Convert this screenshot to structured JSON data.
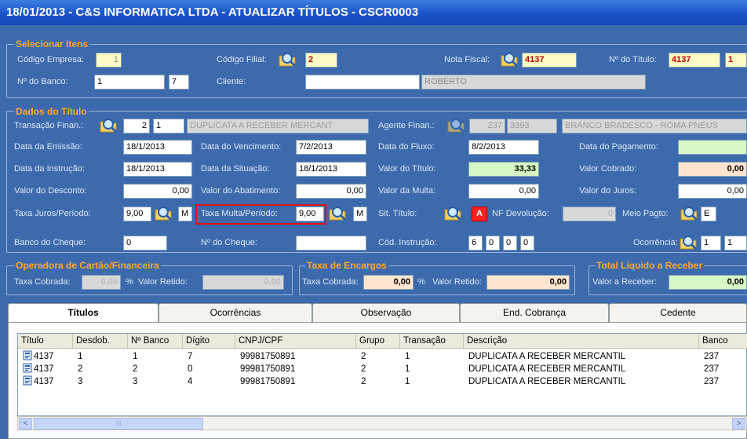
{
  "window": {
    "title": "18/01/2013  -  C&S INFORMATICA LTDA  -  ATUALIZAR TÍTULOS  -  CSCR0003"
  },
  "selecionar": {
    "section_title": "Selecionar Itens",
    "codigo_empresa_label": "Código Empresa:",
    "codigo_empresa": "1",
    "codigo_filial_label": "Código Filial:",
    "codigo_filial": "2",
    "nota_fiscal_label": "Nota Fiscal:",
    "nota_fiscal": "4137",
    "numero_titulo_label": "Nº do Título:",
    "numero_titulo": "4137",
    "numero_titulo_seq": "1",
    "banco_label": "Nº do Banco:",
    "banco": "1",
    "banco_digito": "7",
    "cliente_label": "Cliente:",
    "cliente_codigo": "",
    "cliente_nome": "ROBERTO"
  },
  "dados": {
    "section_title": "Dados do Título",
    "transacao_label": "Transação Finan.:",
    "transacao_1": "2",
    "transacao_2": "1",
    "transacao_desc": "DUPLICATA  A RECEBER MERCANT",
    "agente_label": "Agente Finan.:",
    "agente_1": "237",
    "agente_2": "3393",
    "agente_desc": "BRANCO BRADESCO - ROMA PNEUS",
    "emissao_label": "Data  da Emissão:",
    "emissao": "18/1/2013",
    "vencimento_label": "Data do Vencimento:",
    "vencimento": "7/2/2013",
    "fluxo_label": "Data do Fluxo:",
    "fluxo": "8/2/2013",
    "pagamento_label": "Data do Pagamento:",
    "pagamento": "",
    "instrucao_label": "Data da Instrução:",
    "instrucao": "18/1/2013",
    "situacao_label": "Data da Situação:",
    "situacao": "18/1/2013",
    "valor_titulo_label": "Valor do Título:",
    "valor_titulo": "33,33",
    "valor_cobrado_label": "Valor Cobrado:",
    "valor_cobrado": "0,00",
    "desconto_label": "Valor do Desconto:",
    "desconto": "0,00",
    "abatimento_label": "Valor do Abatimento:",
    "abatimento": "0,00",
    "multa_label": "Valor da Multa:",
    "multa": "0,00",
    "juros_label": "Valor do Juros:",
    "juros": "0,00",
    "taxa_juros_label": "Taxa Juros/Período:",
    "taxa_juros": "9,00",
    "taxa_juros_periodo": "M",
    "taxa_multa_label": "Taxa Multa/Período:",
    "taxa_multa": "9,00",
    "taxa_multa_periodo": "M",
    "sit_titulo_label": "Sit. Título:",
    "sit_titulo": "A",
    "nf_devolucao_label": "NF Devolução:",
    "nf_devolucao": "0",
    "meio_pagto_label": "Meio Pagto:",
    "meio_pagto": "E",
    "banco_cheque_label": "Banco do Cheque:",
    "banco_cheque": "0",
    "num_cheque_label": "Nº do Cheque:",
    "num_cheque": "",
    "cod_instrucao_label": "Cód. Instrução:",
    "cod_instrucao": [
      "6",
      "0",
      "0",
      "0"
    ],
    "ocorrencia_label": "Ocorrência:",
    "ocorrencia_1": "1",
    "ocorrencia_2": "1"
  },
  "operadora": {
    "section_title": "Operadora de Cartão/Financeira",
    "taxa_label": "Taxa Cobrada:",
    "taxa": "0,00",
    "pct": "%",
    "retido_label": "Valor Retido:",
    "retido": "0,00"
  },
  "encargos": {
    "section_title": "Taxa de Encargos",
    "taxa_label": "Taxa Cobrada:",
    "taxa": "0,00",
    "pct": "%",
    "retido_label": "Valor Retido:",
    "retido": "0,00"
  },
  "total": {
    "section_title": "Total Líquido a Receber",
    "label": "Valor a Receber:",
    "value": "0,00"
  },
  "tabs": [
    "Títulos",
    "Ocorrências",
    "Observação",
    "End. Cobrança",
    "Cedente"
  ],
  "grid": {
    "columns": [
      "Título",
      "Desdob.",
      "Nº Banco",
      "Dígito",
      "CNPJ/CPF",
      "Grupo",
      "Transação",
      "Descrição",
      "Banco"
    ],
    "rows": [
      [
        "4137",
        "1",
        "1",
        "7",
        "99981750891",
        "2",
        "1",
        "DUPLICATA  A RECEBER MERCANTIL",
        "237"
      ],
      [
        "4137",
        "2",
        "2",
        "0",
        "99981750891",
        "2",
        "1",
        "DUPLICATA  A RECEBER MERCANTIL",
        "237"
      ],
      [
        "4137",
        "3",
        "3",
        "4",
        "99981750891",
        "2",
        "1",
        "DUPLICATA  A RECEBER MERCANTIL",
        "237"
      ]
    ]
  },
  "scrollbar": {
    "left_arrow": "<",
    "right_arrow": ">",
    "grip": "III"
  },
  "colors": {
    "title_bar": "#1a52c8",
    "background": "#3c6aac",
    "section_title": "#ffa733",
    "highlight_border": "#e01010",
    "required_field": "#fffcc6",
    "sit_badge": "#ff2020"
  },
  "icons": {
    "lookup": "magnifier-folder-icon",
    "row": "document-icon"
  }
}
